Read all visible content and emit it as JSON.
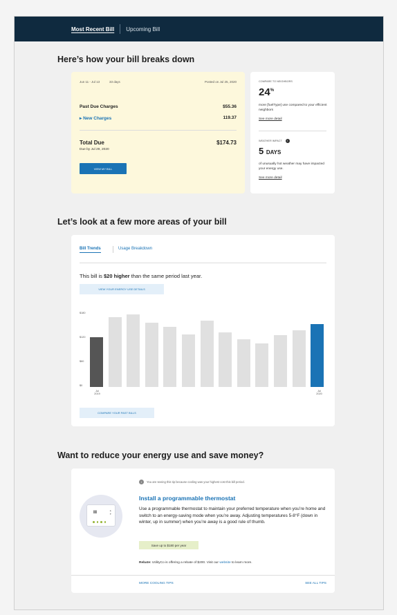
{
  "tabs": {
    "most_recent": "Most Recent Bill",
    "upcoming": "Upcoming Bill"
  },
  "breakdown": {
    "heading": "Here’s how your bill breaks down",
    "period": "Jun 11 - Jul 13",
    "days": "33 days",
    "posted": "Posted on Jul 25, 2020",
    "past_due_label": "Past Due Charges",
    "past_due_value": "$55.36",
    "new_charges_label": "New Charges",
    "new_charges_value": "119.37",
    "total_label": "Total Due",
    "total_value": "$174.73",
    "due_by": "Due by Jul 29, 2020",
    "view_bill": "VIEW MY BILL"
  },
  "neighbors": {
    "label": "COMPARE TO NEIGHBORS",
    "value": "24",
    "unit": "%",
    "desc": "more [fuelType] use compared to your efficient neighbors",
    "link": "See more detail"
  },
  "weather": {
    "label": "WEATHER IMPACT",
    "value": "5",
    "unit": "DAYS",
    "desc": "of unusually hot weather may have impacted your energy use.",
    "link": "See more detail"
  },
  "areas": {
    "heading": "Let’s look at a few more areas of your bill",
    "tab_trends": "Bill Trends",
    "tab_usage": "Usage Breakdown",
    "statement_pre": "This bill is ",
    "statement_bold": "$20 higher",
    "statement_post": " than the same period last year.",
    "energy_btn": "VIEW YOUR ENERGY USE DETAILS",
    "compare_btn": "COMPARE YOUR PAST BILLS"
  },
  "chart_data": {
    "type": "bar",
    "categories": [
      "Jul 2019",
      "",
      "",
      "",
      "",
      "",
      "",
      "",
      "",
      "",
      "",
      "",
      "Jul 2020"
    ],
    "values": [
      154,
      216,
      224,
      200,
      186,
      162,
      206,
      170,
      148,
      134,
      160,
      176,
      196
    ],
    "ylim": [
      0,
      240
    ],
    "yticks": [
      "$0",
      "$60",
      "$120",
      "$180"
    ],
    "x_first": [
      "Jul",
      "2019"
    ],
    "x_last": [
      "Jul",
      "2020"
    ],
    "colors": {
      "first": "#555555",
      "middle": "#e0e0e0",
      "last": "#1a73b5"
    }
  },
  "tips": {
    "heading": "Want to reduce your energy use and save money?",
    "notice": "You are seeing this tip because cooling was your highest cost this bill period.",
    "title": "Install a programmable thermostat",
    "body": "Use a programmable thermostat to maintain your preferred temperature when you’re home and switch to an energy-saving mode when you’re away. Adjusting temperatures 5-8°F (down in winter, up in summer) when you’re away is a good rule of thumb.",
    "save_badge": "Save up to $180 per year",
    "rebate_label": "Rebate:",
    "rebate_pre": " UtilityCo is offering a rebate of $200. Visit our ",
    "rebate_link": "website",
    "rebate_post": " to learn more.",
    "more_tips": "MORE COOLING TIPS",
    "all_tips": "SEE ALL TIPS",
    "thermo_display": "III"
  }
}
